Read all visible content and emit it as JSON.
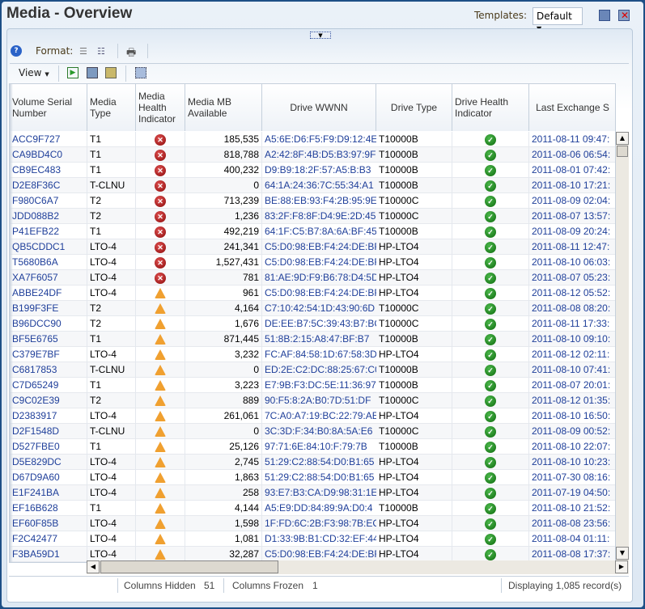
{
  "header": {
    "title": "Media - Overview",
    "templates_label": "Templates:",
    "template_value": "Default"
  },
  "toolbar": {
    "format_label": "Format:",
    "view_label": "View"
  },
  "columns": [
    "Volume Serial Number",
    "Media Type",
    "Media Health Indicator",
    "Media MB Available",
    "Drive WWNN",
    "Drive Type",
    "Drive Health Indicator",
    "Last Exchange S"
  ],
  "rows": [
    [
      "ACC9F727",
      "T1",
      "error",
      "185,535",
      "A5:6E:D6:F5:F9:D9:12:4E",
      "T10000B",
      "ok",
      "2011-08-11 09:47:"
    ],
    [
      "CA9BD4C0",
      "T1",
      "error",
      "818,788",
      "A2:42:8F:4B:D5:B3:97:9F",
      "T10000B",
      "ok",
      "2011-08-06 06:54:"
    ],
    [
      "CB9EC483",
      "T1",
      "error",
      "400,232",
      "D9:B9:18:2F:57:A5:B:B3",
      "T10000B",
      "ok",
      "2011-08-01 07:42:"
    ],
    [
      "D2E8F36C",
      "T-CLNU",
      "error",
      "0",
      "64:1A:24:36:7C:55:34:A1",
      "T10000B",
      "ok",
      "2011-08-10 17:21:"
    ],
    [
      "F980C6A7",
      "T2",
      "error",
      "713,239",
      "BE:88:EB:93:F4:2B:95:9E",
      "T10000C",
      "ok",
      "2011-08-09 02:04:"
    ],
    [
      "JDD088B2",
      "T2",
      "error",
      "1,236",
      "83:2F:F8:8F:D4:9E:2D:45",
      "T10000C",
      "ok",
      "2011-08-07 13:57:"
    ],
    [
      "P41EFB22",
      "T1",
      "error",
      "492,219",
      "64:1F:C5:B7:8A:6A:BF:45",
      "T10000B",
      "ok",
      "2011-08-09 20:24:"
    ],
    [
      "QB5CDDC1",
      "LTO-4",
      "error",
      "241,341",
      "C5:D0:98:EB:F4:24:DE:BF",
      "HP-LTO4",
      "ok",
      "2011-08-11 12:47:"
    ],
    [
      "T5680B6A",
      "LTO-4",
      "error",
      "1,527,431",
      "C5:D0:98:EB:F4:24:DE:BF",
      "HP-LTO4",
      "ok",
      "2011-08-10 06:03:"
    ],
    [
      "XA7F6057",
      "LTO-4",
      "error",
      "781",
      "81:AE:9D:F9:B6:78:D4:5D",
      "HP-LTO4",
      "ok",
      "2011-08-07 05:23:"
    ],
    [
      "ABBE24DF",
      "LTO-4",
      "warning",
      "961",
      "C5:D0:98:EB:F4:24:DE:BF",
      "HP-LTO4",
      "ok",
      "2011-08-12 05:52:"
    ],
    [
      "B199F3FE",
      "T2",
      "warning",
      "4,164",
      "C7:10:42:54:1D:43:90:6D",
      "T10000C",
      "ok",
      "2011-08-08 08:20:"
    ],
    [
      "B96DCC90",
      "T2",
      "warning",
      "1,676",
      "DE:EE:B7:5C:39:43:B7:BC",
      "T10000C",
      "ok",
      "2011-08-11 17:33:"
    ],
    [
      "BF5E6765",
      "T1",
      "warning",
      "871,445",
      "51:8B:2:15:A8:47:BF:B7",
      "T10000B",
      "ok",
      "2011-08-10 09:10:"
    ],
    [
      "C379E7BF",
      "LTO-4",
      "warning",
      "3,232",
      "FC:AF:84:58:1D:67:58:3D",
      "HP-LTO4",
      "ok",
      "2011-08-12 02:11:"
    ],
    [
      "C6817853",
      "T-CLNU",
      "warning",
      "0",
      "ED:2E:C2:DC:88:25:67:C0",
      "T10000B",
      "ok",
      "2011-08-10 07:41:"
    ],
    [
      "C7D65249",
      "T1",
      "warning",
      "3,223",
      "E7:9B:F3:DC:5E:11:36:97",
      "T10000B",
      "ok",
      "2011-08-07 20:01:"
    ],
    [
      "C9C02E39",
      "T2",
      "warning",
      "889",
      "90:F5:8:2A:B0:7D:51:DF",
      "T10000C",
      "ok",
      "2011-08-12 01:35:"
    ],
    [
      "D2383917",
      "LTO-4",
      "warning",
      "261,061",
      "7C:A0:A7:19:BC:22:79:AE",
      "HP-LTO4",
      "ok",
      "2011-08-10 16:50:"
    ],
    [
      "D2F1548D",
      "T-CLNU",
      "warning",
      "0",
      "3C:3D:F:34:B0:8A:5A:E6",
      "T10000C",
      "ok",
      "2011-08-09 00:52:"
    ],
    [
      "D527FBE0",
      "T1",
      "warning",
      "25,126",
      "97:71:6E:84:10:F:79:7B",
      "T10000B",
      "ok",
      "2011-08-10 22:07:"
    ],
    [
      "D5E829DC",
      "LTO-4",
      "warning",
      "2,745",
      "51:29:C2:88:54:D0:B1:65",
      "HP-LTO4",
      "ok",
      "2011-08-10 10:23:"
    ],
    [
      "D67D9A60",
      "LTO-4",
      "warning",
      "1,863",
      "51:29:C2:88:54:D0:B1:65",
      "HP-LTO4",
      "ok",
      "2011-07-30 08:16:"
    ],
    [
      "E1F241BA",
      "LTO-4",
      "warning",
      "258",
      "93:E7:B3:CA:D9:98:31:1E",
      "HP-LTO4",
      "ok",
      "2011-07-19 04:50:"
    ],
    [
      "EF16B628",
      "T1",
      "warning",
      "4,144",
      "A5:E9:DD:84:89:9A:D0:4",
      "T10000B",
      "ok",
      "2011-08-10 21:52:"
    ],
    [
      "EF60F85B",
      "LTO-4",
      "warning",
      "1,598",
      "1F:FD:6C:2B:F3:98:7B:EC",
      "HP-LTO4",
      "ok",
      "2011-08-08 23:56:"
    ],
    [
      "F2C42477",
      "LTO-4",
      "warning",
      "1,081",
      "D1:33:9B:B1:CD:32:EF:44",
      "HP-LTO4",
      "ok",
      "2011-08-04 01:11:"
    ],
    [
      "F3BA59D1",
      "LTO-4",
      "warning",
      "32,287",
      "C5:D0:98:EB:F4:24:DE:BF",
      "HP-LTO4",
      "ok",
      "2011-08-08 17:37:"
    ]
  ],
  "status": {
    "hidden_label": "Columns Hidden",
    "hidden_value": "51",
    "frozen_label": "Columns Frozen",
    "frozen_value": "1",
    "displaying": "Displaying 1,085 record(s)"
  },
  "colors": {
    "link": "#1f3f9a",
    "background": "#1d4f86"
  }
}
